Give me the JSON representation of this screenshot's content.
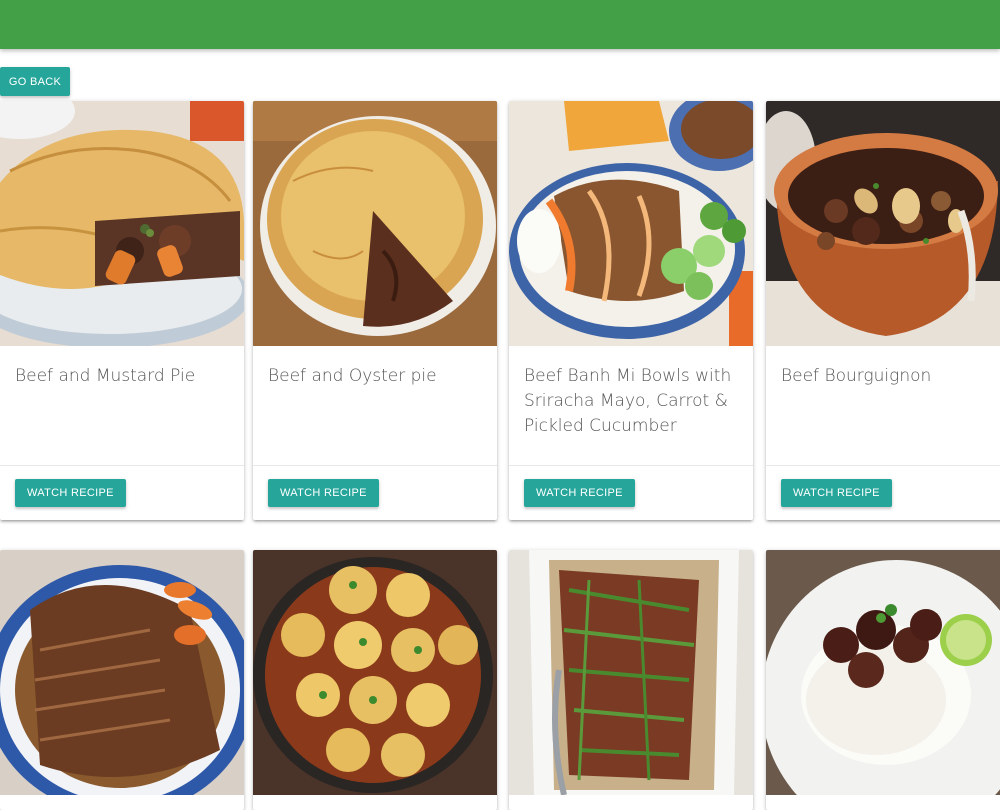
{
  "header": {
    "color": "#43a047"
  },
  "nav": {
    "go_back_label": "GO BACK"
  },
  "accent_color": "#26a69a",
  "recipes": [
    {
      "title": "Beef and Mustard Pie",
      "action_label": "WATCH RECIPE",
      "image": "meat-pie-photo"
    },
    {
      "title": "Beef and Oyster pie",
      "action_label": "WATCH RECIPE",
      "image": "oyster-pie-photo"
    },
    {
      "title": "Beef Banh Mi Bowls with Sriracha Mayo, Carrot & Pickled Cucumber",
      "action_label": "WATCH RECIPE",
      "image": "banh-mi-bowl-photo"
    },
    {
      "title": "Beef Bourguignon",
      "action_label": "WATCH RECIPE",
      "image": "bourguignon-photo"
    },
    {
      "title": "",
      "action_label": "",
      "image": "brisket-platter-photo"
    },
    {
      "title": "",
      "action_label": "",
      "image": "dumpling-stew-photo"
    },
    {
      "title": "",
      "action_label": "",
      "image": "beef-green-beans-photo"
    },
    {
      "title": "",
      "action_label": "",
      "image": "beef-rice-lime-photo"
    }
  ]
}
